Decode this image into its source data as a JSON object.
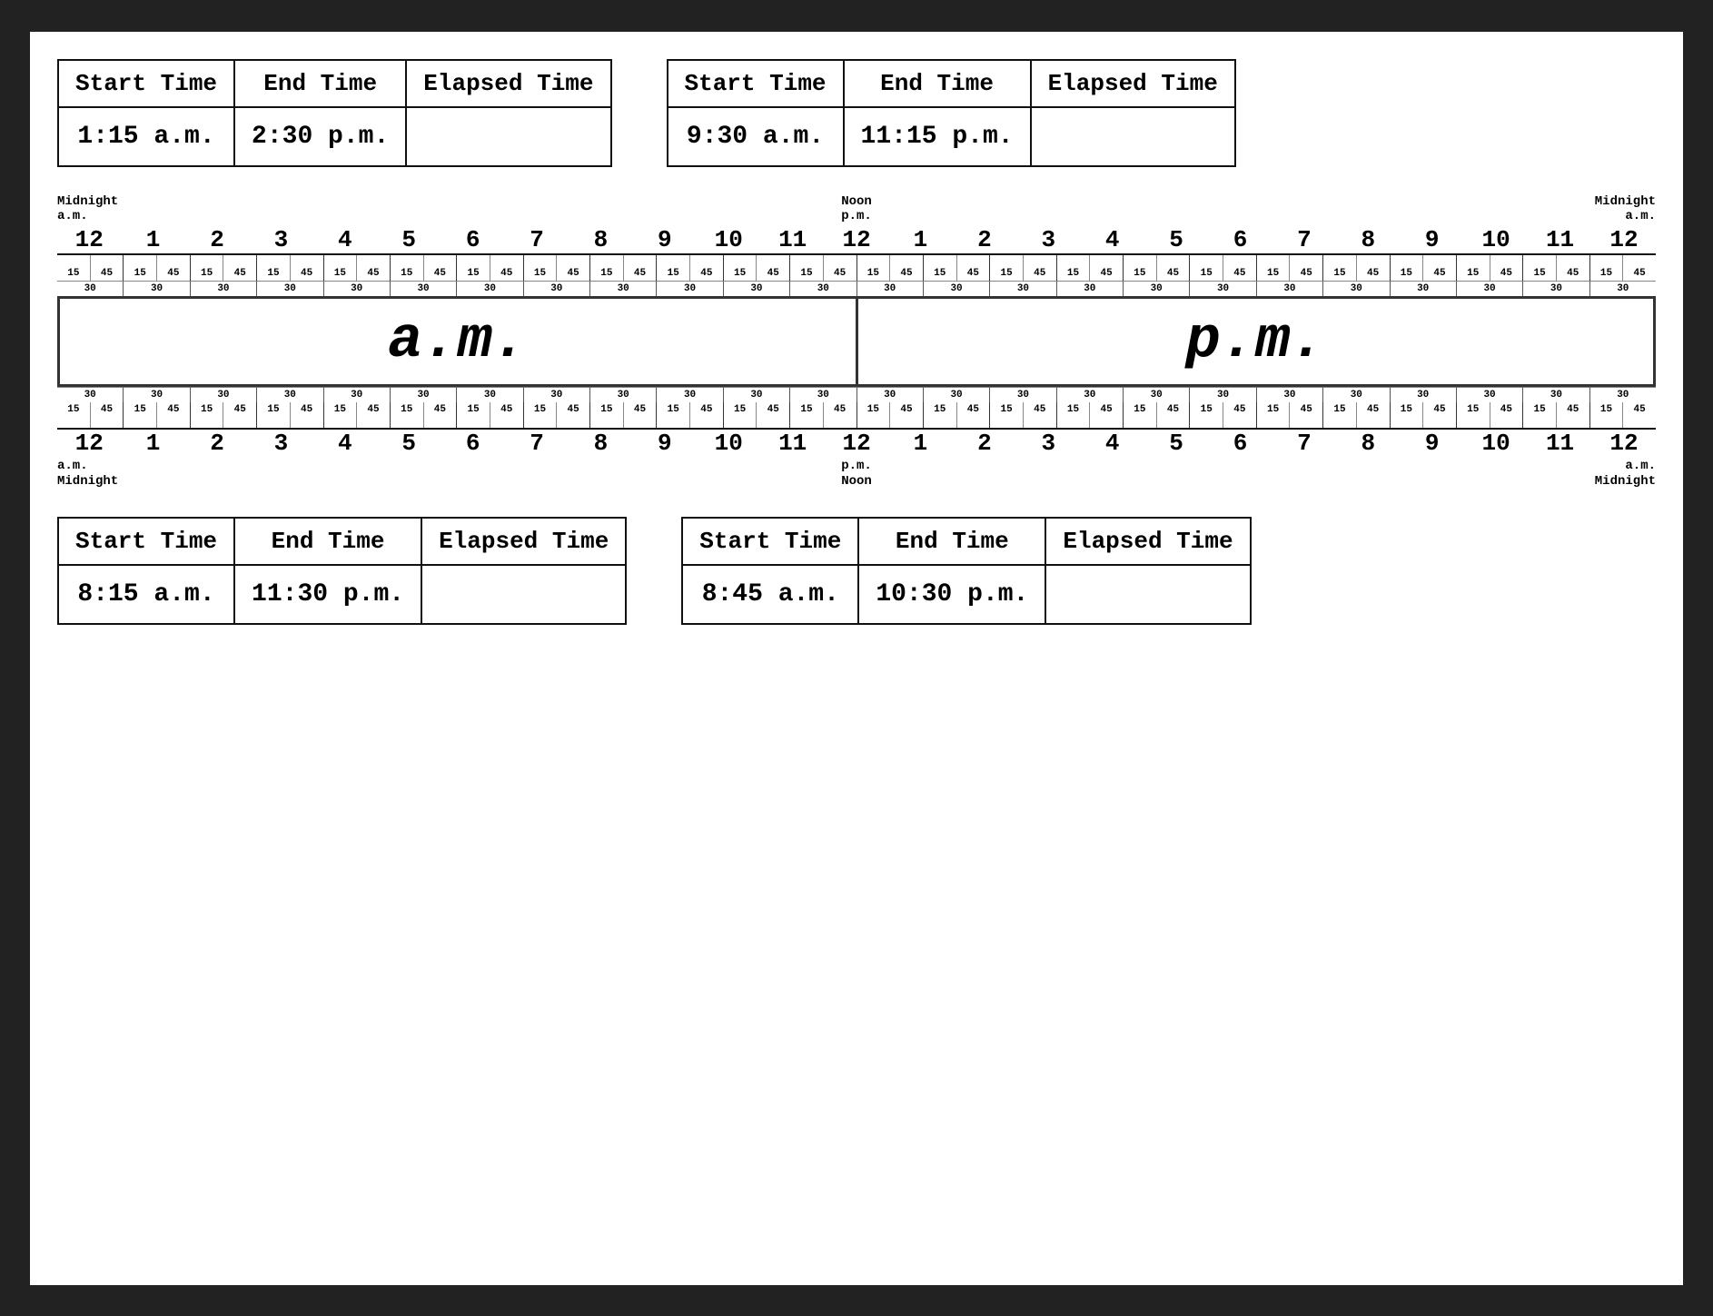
{
  "table1": {
    "col1": "Start Time",
    "col2": "End Time",
    "col3": "Elapsed Time",
    "start": "1:15 a.m.",
    "end": "2:30 p.m.",
    "elapsed": ""
  },
  "table2": {
    "col1": "Start Time",
    "col2": "End Time",
    "col3": "Elapsed Time",
    "start": "9:30 a.m.",
    "end": "11:15 p.m.",
    "elapsed": ""
  },
  "table3": {
    "col1": "Start Time",
    "col2": "End Time",
    "col3": "Elapsed Time",
    "start": "8:15 a.m.",
    "end": "11:30 p.m.",
    "elapsed": ""
  },
  "table4": {
    "col1": "Start Time",
    "col2": "End Time",
    "col3": "Elapsed Time",
    "start": "8:45 a.m.",
    "end": "10:30 p.m.",
    "elapsed": ""
  },
  "timeline": {
    "hours": [
      "12",
      "1",
      "2",
      "3",
      "4",
      "5",
      "6",
      "7",
      "8",
      "9",
      "10",
      "11",
      "12",
      "1",
      "2",
      "3",
      "4",
      "5",
      "6",
      "7",
      "8",
      "9",
      "10",
      "11",
      "12"
    ],
    "ticks_top": [
      "15",
      "45",
      "15",
      "45",
      "15",
      "45",
      "15",
      "45",
      "15",
      "45",
      "15",
      "45",
      "15",
      "45",
      "15",
      "45",
      "15",
      "45",
      "15",
      "45",
      "15",
      "45",
      "15",
      "45",
      "15",
      "45",
      "15",
      "45",
      "15",
      "45",
      "15",
      "45",
      "15",
      "45",
      "15",
      "45",
      "15",
      "45",
      "15",
      "45",
      "15",
      "45",
      "15",
      "45",
      "15",
      "45",
      "15",
      "45"
    ],
    "thirties": [
      "30",
      "30",
      "30",
      "30",
      "30",
      "30",
      "30",
      "30",
      "30",
      "30",
      "30",
      "30",
      "30",
      "30",
      "30",
      "30",
      "30",
      "30",
      "30",
      "30",
      "30",
      "30",
      "30",
      "30"
    ],
    "am_label": "a.m.",
    "pm_label": "p.m.",
    "midnight_label": "Midnight",
    "noon_label": "Noon",
    "top_left_midnight": "Midnight",
    "top_left_am": "a.m.",
    "top_mid_noon": "Noon",
    "top_mid_pm": "p.m.",
    "top_right_midnight": "Midnight",
    "top_right_am": "a.m.",
    "bot_left_am": "a.m.",
    "bot_left_midnight": "Midnight",
    "bot_mid_pm": "p.m.",
    "bot_mid_noon": "Noon",
    "bot_right_am": "a.m.",
    "bot_right_midnight": "Midnight"
  }
}
